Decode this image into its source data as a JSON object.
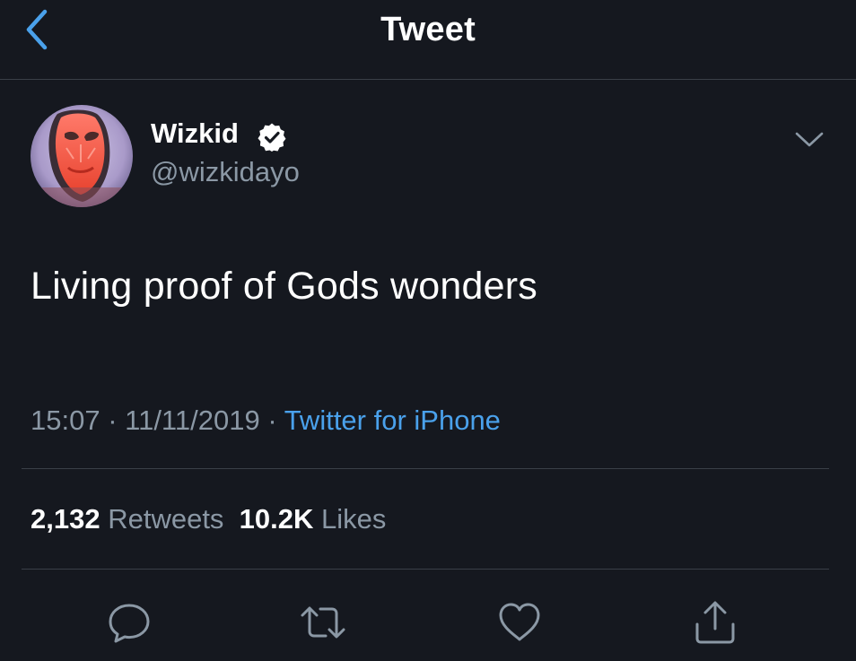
{
  "header": {
    "title": "Tweet",
    "back_icon": "chevron-left-icon"
  },
  "author": {
    "display_name": "Wizkid",
    "handle": "@wizkidayo",
    "verified": true
  },
  "tweet": {
    "text": "Living proof of Gods wonders",
    "time": "15:07",
    "date": "11/11/2019",
    "separator": " · ",
    "source": "Twitter for iPhone"
  },
  "stats": {
    "retweets_count": "2,132",
    "retweets_label": "Retweets",
    "likes_count": "10.2K",
    "likes_label": "Likes"
  },
  "actions": {
    "reply_icon": "reply-icon",
    "retweet_icon": "retweet-icon",
    "like_icon": "heart-icon",
    "share_icon": "share-icon"
  },
  "colors": {
    "background": "#15181f",
    "accent": "#4aa1eb",
    "secondary_text": "#8b98a5",
    "divider": "#3a3f47"
  }
}
